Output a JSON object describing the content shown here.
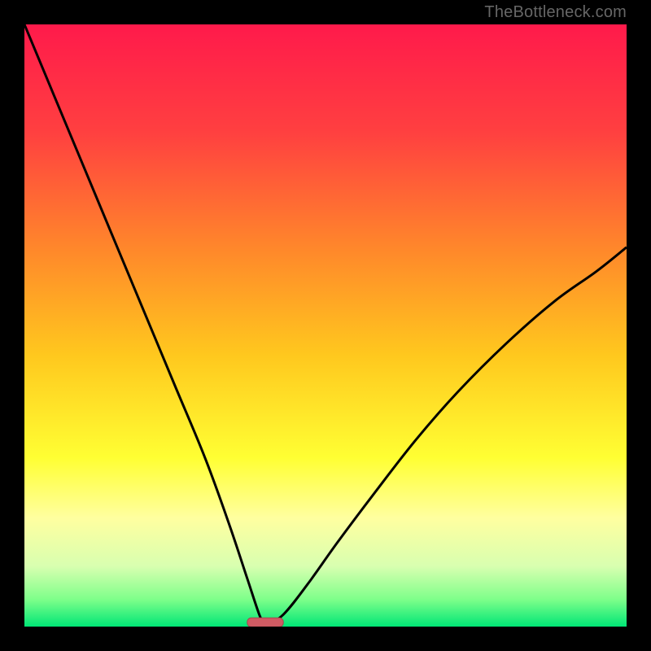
{
  "watermark": "TheBottleneck.com",
  "colors": {
    "frame": "#000000",
    "curve": "#000000",
    "marker_fill": "#cf5b63",
    "marker_stroke": "#a64650",
    "gradient_stops": [
      {
        "offset": 0.0,
        "color": "#ff1a4b"
      },
      {
        "offset": 0.18,
        "color": "#ff4040"
      },
      {
        "offset": 0.38,
        "color": "#ff8a2a"
      },
      {
        "offset": 0.55,
        "color": "#ffc81e"
      },
      {
        "offset": 0.72,
        "color": "#ffff33"
      },
      {
        "offset": 0.82,
        "color": "#ffffa0"
      },
      {
        "offset": 0.9,
        "color": "#d8ffb0"
      },
      {
        "offset": 0.955,
        "color": "#7eff8a"
      },
      {
        "offset": 1.0,
        "color": "#00e676"
      }
    ]
  },
  "chart_data": {
    "type": "line",
    "title": "",
    "xlabel": "",
    "ylabel": "",
    "xlim": [
      0,
      100
    ],
    "ylim": [
      0,
      100
    ],
    "annotations": [
      "TheBottleneck.com"
    ],
    "min_x": 40,
    "curve": {
      "description": "V-shaped bottleneck curve; left branch from top-left down to minimum, right branch rising to mid-right",
      "left_branch": [
        {
          "x": 0,
          "y": 100
        },
        {
          "x": 5,
          "y": 88
        },
        {
          "x": 10,
          "y": 76
        },
        {
          "x": 15,
          "y": 64
        },
        {
          "x": 20,
          "y": 52
        },
        {
          "x": 25,
          "y": 40
        },
        {
          "x": 30,
          "y": 28
        },
        {
          "x": 34,
          "y": 17
        },
        {
          "x": 37,
          "y": 8
        },
        {
          "x": 39,
          "y": 2
        },
        {
          "x": 40,
          "y": 0
        }
      ],
      "right_branch": [
        {
          "x": 40,
          "y": 0
        },
        {
          "x": 43,
          "y": 2
        },
        {
          "x": 47,
          "y": 7
        },
        {
          "x": 52,
          "y": 14
        },
        {
          "x": 58,
          "y": 22
        },
        {
          "x": 65,
          "y": 31
        },
        {
          "x": 72,
          "y": 39
        },
        {
          "x": 80,
          "y": 47
        },
        {
          "x": 88,
          "y": 54
        },
        {
          "x": 95,
          "y": 59
        },
        {
          "x": 100,
          "y": 63
        }
      ]
    },
    "marker": {
      "x": 40,
      "y": 0.7,
      "w": 6,
      "h": 1.5
    }
  }
}
